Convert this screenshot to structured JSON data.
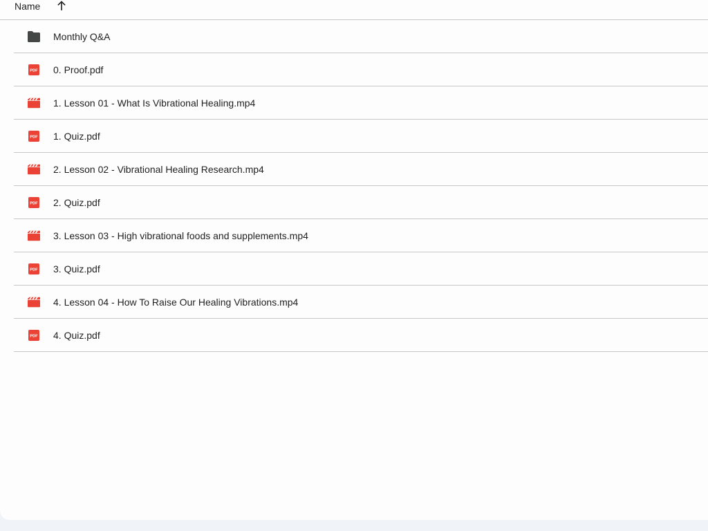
{
  "header": {
    "name_label": "Name",
    "sort_icon": "arrow-up-icon"
  },
  "colors": {
    "folder": "#444746",
    "file_red": "#ea4335",
    "divider": "#c7c7c7",
    "text": "#1f1f1f"
  },
  "files": [
    {
      "name": "Monthly Q&A",
      "type": "folder",
      "icon": "folder-icon"
    },
    {
      "name": "0. Proof.pdf",
      "type": "pdf",
      "icon": "pdf-icon"
    },
    {
      "name": "1. Lesson 01 - What Is Vibrational Healing.mp4",
      "type": "video",
      "icon": "video-icon"
    },
    {
      "name": "1. Quiz.pdf",
      "type": "pdf",
      "icon": "pdf-icon"
    },
    {
      "name": "2. Lesson 02 - Vibrational Healing Research.mp4",
      "type": "video",
      "icon": "video-icon"
    },
    {
      "name": "2. Quiz.pdf",
      "type": "pdf",
      "icon": "pdf-icon"
    },
    {
      "name": "3. Lesson 03 - High vibrational foods and supplements.mp4",
      "type": "video",
      "icon": "video-icon"
    },
    {
      "name": "3. Quiz.pdf",
      "type": "pdf",
      "icon": "pdf-icon"
    },
    {
      "name": "4. Lesson 04 - How To Raise Our Healing Vibrations.mp4",
      "type": "video",
      "icon": "video-icon"
    },
    {
      "name": "4. Quiz.pdf",
      "type": "pdf",
      "icon": "pdf-icon"
    }
  ]
}
